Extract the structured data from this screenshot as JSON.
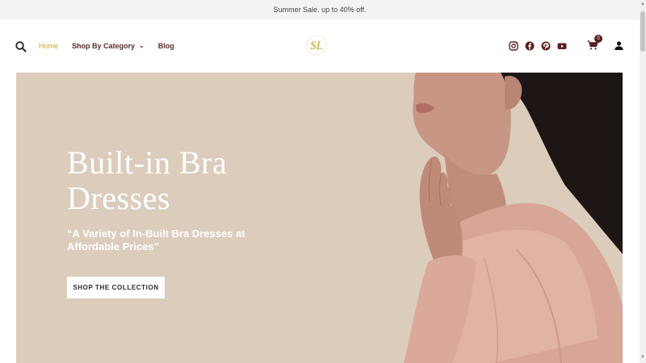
{
  "announcement": {
    "text": "Summer Sale. up to 40% off."
  },
  "nav": {
    "items": [
      {
        "label": "Home"
      },
      {
        "label": "Shop By Category"
      },
      {
        "label": "Blog"
      }
    ]
  },
  "header": {
    "logo_mark": "SL",
    "cart_count": "0",
    "social_icons": [
      "instagram-icon",
      "facebook-icon",
      "pinterest-icon",
      "youtube-icon"
    ],
    "colors": {
      "accent": "#c9a227",
      "brand": "#5a2a2a",
      "hero_bg": "#dcccbc"
    }
  },
  "hero": {
    "title": "Built-in Bra Dresses",
    "subtitle": "“A Variety of In-Built Bra Dresses at Affordable Prices”",
    "cta_label": "SHOP THE COLLECTION"
  }
}
